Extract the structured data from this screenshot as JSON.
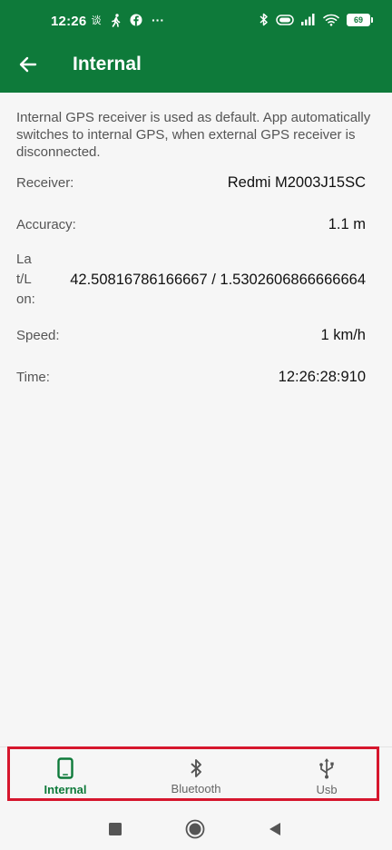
{
  "status_bar": {
    "time": "12:26",
    "battery": "69",
    "left_icons": [
      "chinese-text-icon",
      "walking-icon",
      "facebook-icon",
      "more-icon"
    ],
    "right_icons": [
      "bluetooth-icon",
      "vibrate-icon",
      "signal-icon",
      "wifi-icon",
      "battery-icon"
    ],
    "left_glyphs": {
      "chinese_text": "谈",
      "more": "···"
    }
  },
  "app_bar": {
    "title": "Internal",
    "back_icon": "arrow-left-icon",
    "background": "#0e7a3a"
  },
  "content": {
    "description": "Internal GPS receiver is used as default. App automatically switches to internal GPS, when external GPS receiver is disconnected.",
    "rows": {
      "receiver": {
        "label": "Receiver:",
        "value": "Redmi M2003J15SC"
      },
      "accuracy": {
        "label": "Accuracy:",
        "value": "1.1 m"
      },
      "latlon": {
        "label": "Lat/Lon:",
        "value": "42.50816786166667 / 1.5302606866666664"
      },
      "speed": {
        "label": "Speed:",
        "value": "1 km/h"
      },
      "time": {
        "label": "Time:",
        "value": "12:26:28:910"
      }
    }
  },
  "bottom_nav": {
    "items": [
      {
        "label": "Internal",
        "icon": "phone-icon",
        "active": true
      },
      {
        "label": "Bluetooth",
        "icon": "bluetooth-icon",
        "active": false
      },
      {
        "label": "Usb",
        "icon": "usb-icon",
        "active": false
      }
    ],
    "active_color": "#0e7a3a",
    "highlight_color": "#d6162d"
  },
  "system_nav": {
    "buttons": [
      "recents-square-icon",
      "home-circle-icon",
      "back-triangle-icon"
    ]
  }
}
